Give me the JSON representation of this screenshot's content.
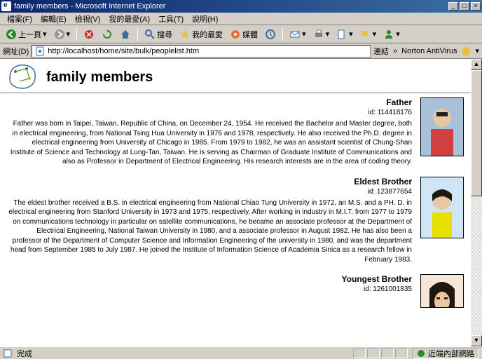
{
  "window": {
    "title": "family members - Microsoft Internet Explorer"
  },
  "menu": {
    "file": "檔案(F)",
    "edit": "編輯(E)",
    "view": "檢視(V)",
    "favorites": "我的最愛(A)",
    "tools": "工具(T)",
    "help": "說明(H)"
  },
  "toolbar": {
    "back": "上一頁",
    "search": "搜尋",
    "favorites": "我的最愛",
    "media": "媒體"
  },
  "address": {
    "label": "網址(D)",
    "url": "http://localhost/home/site/bulk/peoplelist.htm",
    "links": "連結",
    "antivirus": "Norton AntiVirus"
  },
  "page": {
    "title": "family members"
  },
  "members": [
    {
      "name": "Father",
      "id": "id: 114418176",
      "desc": "Father was born in Taipei, Taiwan, Republic of China, on December 24, 1954. He received the Bachelor and Master degree, both in electrical engineering, from National Tsing Hua University in 1976 and 1978, respectively. He also received the Ph.D. degree in electrical engineering from University of Chicago in 1985. From 1979 to 1982, he was an assistant scientist of Chung-Shan Institute of Science and Technology at Lung-Tan, Taiwan. He is serving as Chairman of Graduate Institute of Communications and also as Professor in Department of Electrical Engineering. His research interests are in the area of coding theory."
    },
    {
      "name": "Eldest Brother",
      "id": "id: 123877654",
      "desc": "The eldest brother received a B.S. in electrical engineering from National Chiao Tung University in 1972, an M.S. and a PH. D. in electrical engineering from Stanford University in 1973 and 1975, respectively. After working in industry in M.I.T. from 1977 to 1979 on communications technology in particular on satellite communications, he became an associate professor at the Department of Electrical Engineering, National Taiwan University in 1980, and a associate professor in August 1982. He has also been a professor of the Department of Computer Science and Information Engineering of the university in 1980, and was the department head from September 1985 to July 1987. He joined the Institute of Information Science of Academia Sinica as a research fellow in February 1983."
    },
    {
      "name": "Youngest Brother",
      "id": "id: 1261001835",
      "desc": ""
    }
  ],
  "status": {
    "done": "完成",
    "zone": "近端內部網路"
  }
}
